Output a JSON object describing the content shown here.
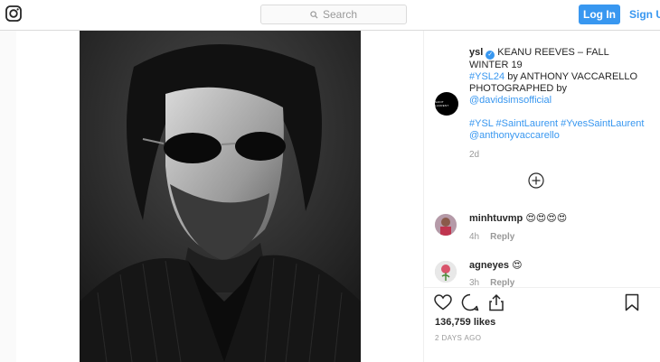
{
  "nav": {
    "logo": "instagram-camera-icon",
    "search_placeholder": "Search",
    "login_label": "Log In",
    "signup_label": "Sign Up"
  },
  "post": {
    "avatar_text": "SAINT LAURENT",
    "username": "ysl",
    "caption_line1": "KEANU REEVES – FALL WINTER 19",
    "caption_tag1": "#YSL24",
    "caption_text1": " by ANTHONY VACCARELLO PHOTOGRAPHED by ",
    "caption_mention1": "@davidsimsofficial",
    "caption_tags2": "#YSL #SaintLaurent #YvesSaintLaurent",
    "caption_mention2": "@anthonyvaccarello",
    "age": "2d",
    "likes": "136,759 likes",
    "timestamp": "2 DAYS AGO"
  },
  "comments": [
    {
      "user": "minhtuvmp",
      "text": "😍😍😍😍",
      "age": "4h",
      "reply": "Reply"
    },
    {
      "user": "agneyes",
      "text": "😍",
      "age": "3h",
      "reply": "Reply"
    }
  ],
  "colors": {
    "accent": "#3897f0",
    "link": "#003569",
    "muted": "#999999"
  }
}
